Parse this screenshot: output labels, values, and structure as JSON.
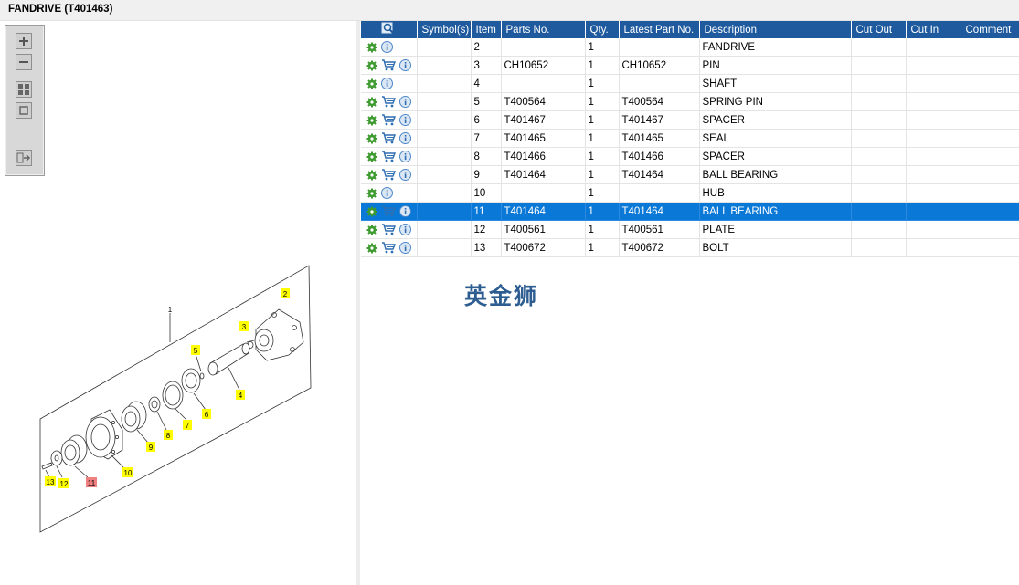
{
  "window": {
    "title": "FANDRIVE (T401463)"
  },
  "toolbar": {
    "buttons": [
      {
        "name": "zoom-in",
        "icon": "plus-icon"
      },
      {
        "name": "zoom-out",
        "icon": "minus-icon"
      },
      {
        "name": "fit-all",
        "icon": "fit-all-icon"
      },
      {
        "name": "fit-window",
        "icon": "fit-window-icon"
      },
      {
        "name": "toggle-list",
        "icon": "list-arrow-icon"
      }
    ]
  },
  "drawing": {
    "callouts": [
      {
        "label": "1",
        "highlight": "none"
      },
      {
        "label": "2",
        "highlight": "yellow"
      },
      {
        "label": "3",
        "highlight": "yellow"
      },
      {
        "label": "4",
        "highlight": "yellow"
      },
      {
        "label": "5",
        "highlight": "yellow"
      },
      {
        "label": "6",
        "highlight": "yellow"
      },
      {
        "label": "7",
        "highlight": "yellow"
      },
      {
        "label": "8",
        "highlight": "yellow"
      },
      {
        "label": "9",
        "highlight": "yellow"
      },
      {
        "label": "10",
        "highlight": "yellow"
      },
      {
        "label": "11",
        "highlight": "red"
      },
      {
        "label": "12",
        "highlight": "yellow"
      },
      {
        "label": "13",
        "highlight": "yellow"
      }
    ]
  },
  "table": {
    "headers": {
      "icon": "search-icon",
      "symbols": "Symbol(s)",
      "item": "Item",
      "parts_no": "Parts No.",
      "qty": "Qty.",
      "latest": "Latest Part No.",
      "description": "Description",
      "cut_out": "Cut Out",
      "cut_in": "Cut In",
      "comment": "Comment"
    },
    "rows": [
      {
        "cart": false,
        "item": "2",
        "parts_no": "",
        "qty": "1",
        "latest": "",
        "description": "FANDRIVE",
        "selected": false
      },
      {
        "cart": true,
        "item": "3",
        "parts_no": "CH10652",
        "qty": "1",
        "latest": "CH10652",
        "description": "PIN",
        "selected": false
      },
      {
        "cart": false,
        "item": "4",
        "parts_no": "",
        "qty": "1",
        "latest": "",
        "description": "SHAFT",
        "selected": false
      },
      {
        "cart": true,
        "item": "5",
        "parts_no": "T400564",
        "qty": "1",
        "latest": "T400564",
        "description": "SPRING PIN",
        "selected": false
      },
      {
        "cart": true,
        "item": "6",
        "parts_no": "T401467",
        "qty": "1",
        "latest": "T401467",
        "description": "SPACER",
        "selected": false
      },
      {
        "cart": true,
        "item": "7",
        "parts_no": "T401465",
        "qty": "1",
        "latest": "T401465",
        "description": "SEAL",
        "selected": false
      },
      {
        "cart": true,
        "item": "8",
        "parts_no": "T401466",
        "qty": "1",
        "latest": "T401466",
        "description": "SPACER",
        "selected": false
      },
      {
        "cart": true,
        "item": "9",
        "parts_no": "T401464",
        "qty": "1",
        "latest": "T401464",
        "description": "BALL BEARING",
        "selected": false
      },
      {
        "cart": false,
        "item": "10",
        "parts_no": "",
        "qty": "1",
        "latest": "",
        "description": "HUB",
        "selected": false
      },
      {
        "cart": true,
        "item": "11",
        "parts_no": "T401464",
        "qty": "1",
        "latest": "T401464",
        "description": "BALL BEARING",
        "selected": true
      },
      {
        "cart": true,
        "item": "12",
        "parts_no": "T400561",
        "qty": "1",
        "latest": "T400561",
        "description": "PLATE",
        "selected": false
      },
      {
        "cart": true,
        "item": "13",
        "parts_no": "T400672",
        "qty": "1",
        "latest": "T400672",
        "description": "BOLT",
        "selected": false
      }
    ]
  },
  "watermark": "英金狮",
  "colors": {
    "header_bg": "#1f5a9e",
    "selected_row": "#0a78d7",
    "gear": "#3e9b2f",
    "cart": "#2f6fb2",
    "info": "#4a86c8",
    "callout_yellow": "#ffff00",
    "callout_red": "#f08080"
  }
}
